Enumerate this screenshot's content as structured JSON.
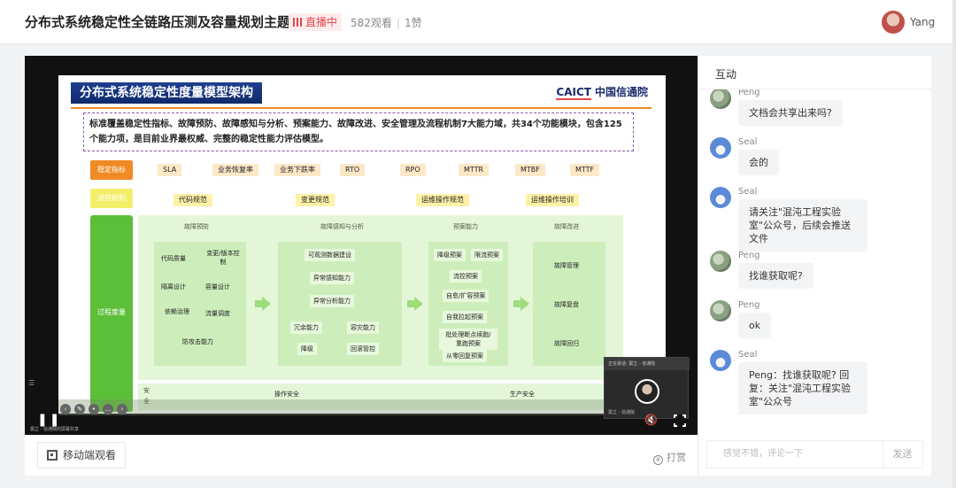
{
  "header": {
    "title": "分布式系统稳定性全链路压测及容量规划主题沙龙",
    "live_label": "直播中",
    "views": "582观看",
    "likes": "1赞",
    "user_name": "Yang"
  },
  "slide": {
    "title": "分布式系统稳定性度量模型架构",
    "logo_caict": "CAICT",
    "logo_cn": "中国信通院",
    "description": "标准覆盖稳定性指标、故障预防、故障感知与分析、预案能力、故障改进、安全管理及流程机制7大能力域，共34个功能模块，包含125个能力项，是目前业界最权威、完整的稳定性能力评估模型。",
    "row_metrics_label": "稳定指标",
    "row_process_label": "流程机制",
    "metrics": [
      "SLA",
      "业务恢复率",
      "业务下跌率",
      "RTO",
      "RPO",
      "MTTR",
      "MTBF",
      "MTTF"
    ],
    "process_items": [
      "代码规范",
      "变更规范",
      "运维操作规范",
      "运维操作培训"
    ],
    "process_measure_label": "过程度量",
    "panels": {
      "prevention": {
        "title": "故障预防",
        "items": [
          "代码质量",
          "变更/版本控制",
          "隔离设计",
          "容量设计",
          "依赖治理",
          "流量调度",
          "防攻击能力"
        ]
      },
      "perception": {
        "title": "故障感知与分析",
        "items": [
          "可观测数据建设",
          "异常感知能力",
          "异常分析能力",
          "冗余能力",
          "容灾能力",
          "降级",
          "回滚管控"
        ]
      },
      "plan": {
        "title": "预案能力",
        "items": [
          "降级预案",
          "限流预案",
          "流控预案",
          "自愈/扩容预案",
          "自我拉起预案",
          "批处理断点续跑/重跑预案",
          "从零回复预案"
        ]
      },
      "improve": {
        "title": "故障改进",
        "items": [
          "故障管理",
          "故障复盘",
          "故障回归"
        ]
      }
    },
    "safety_label": "安全",
    "safety_items": [
      "操作安全",
      "生产安全"
    ]
  },
  "video": {
    "pause_glyph": "❚❚",
    "pip_header": "正在讲话: 窦立 - 信通院",
    "pip_name": "窦立 - 信通院",
    "bottom_caption": "窦立 - 信通院的屏幕共享",
    "mute_glyph": "🔇"
  },
  "below": {
    "mobile_watch": "移动端观看",
    "reward": "打赏"
  },
  "chat": {
    "title": "互动",
    "messages": [
      {
        "name": "Peng",
        "text": "文档会共享出来吗?"
      },
      {
        "name": "Seal",
        "text": "会的"
      },
      {
        "name": "Seal",
        "text": "请关注\"混沌工程实验室\"公众号，后续会推送文件"
      },
      {
        "name": "Peng",
        "text": "找谁获取呢?"
      },
      {
        "name": "Peng",
        "text": "ok"
      },
      {
        "name": "Seal",
        "text": "Peng：找谁获取呢? 回复：关注\"混沌工程实验室\"公众号"
      }
    ],
    "input_placeholder": "感觉不错，评论一下",
    "send_label": "发送"
  }
}
